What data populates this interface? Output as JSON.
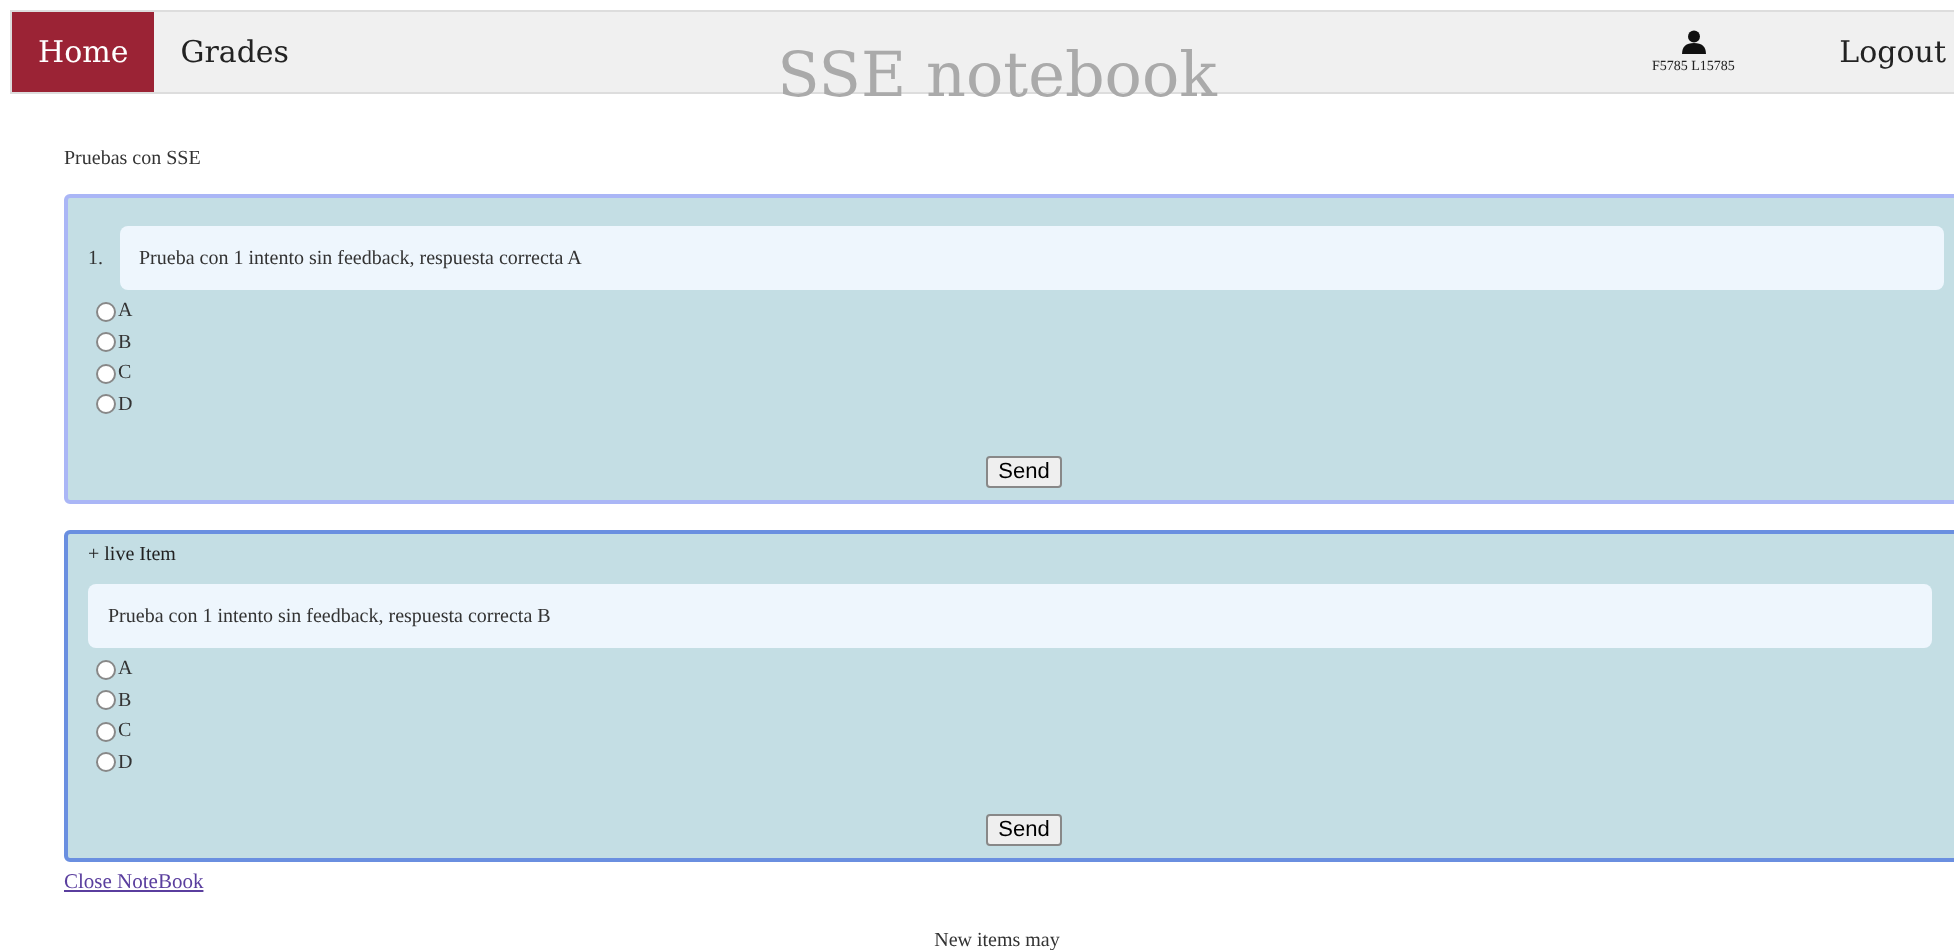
{
  "nav": {
    "tabs": [
      {
        "label": "Home",
        "selected": true
      },
      {
        "label": "Grades",
        "selected": false
      }
    ],
    "user": "F5785 L15785",
    "logout": "Logout"
  },
  "title": "SSE notebook",
  "notebook_name": "Pruebas con SSE",
  "items": [
    {
      "kind": "numbered",
      "number": "1.",
      "question": "Prueba con 1 intento sin feedback, respuesta correcta A",
      "options": [
        {
          "label": "A",
          "selected": false
        },
        {
          "label": "B",
          "selected": false
        },
        {
          "label": "C",
          "selected": false
        },
        {
          "label": "D",
          "selected": false
        }
      ],
      "button": "Send"
    },
    {
      "kind": "live",
      "header": "+ live Item",
      "question": "Prueba con 1 intento sin feedback, respuesta correcta B",
      "options": [
        {
          "label": "A",
          "selected": false
        },
        {
          "label": "B",
          "selected": false
        },
        {
          "label": "C",
          "selected": false
        },
        {
          "label": "D",
          "selected": false
        }
      ],
      "button": "Send"
    }
  ],
  "close_link": "Close NoteBook",
  "footer": "New items may"
}
